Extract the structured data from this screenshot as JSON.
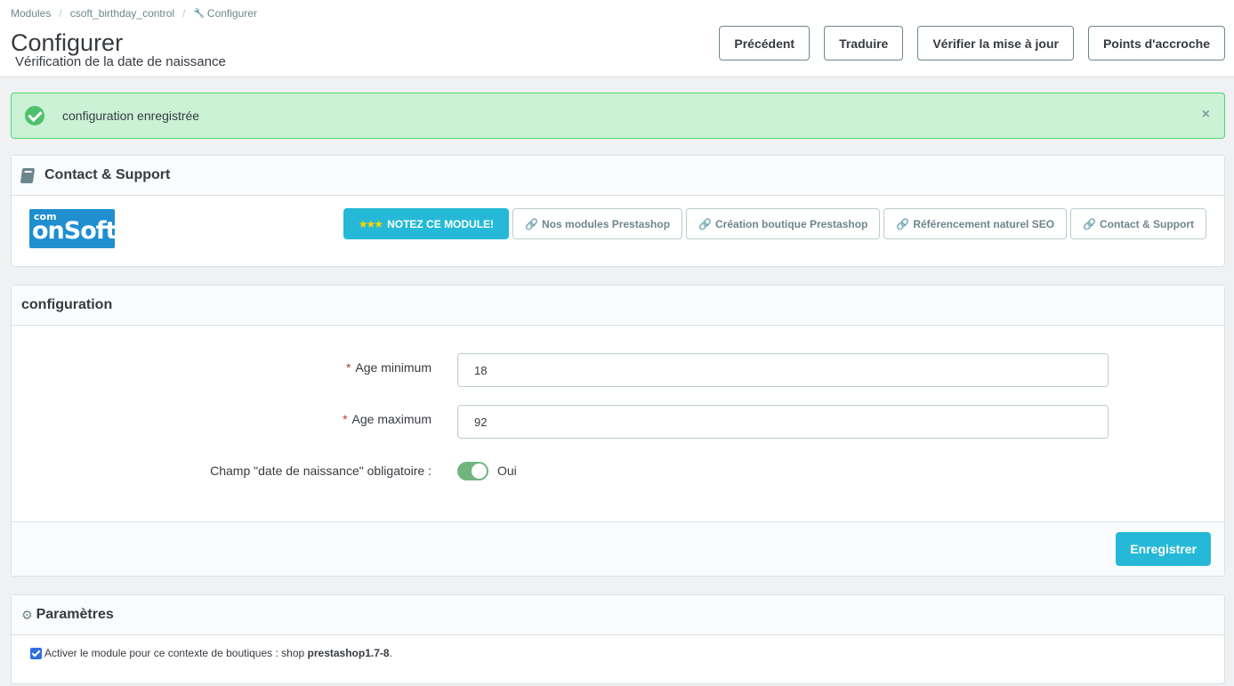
{
  "breadcrumb": {
    "item1": "Modules",
    "item2": "csoft_birthday_control",
    "item3": "Configurer",
    "separator": "/"
  },
  "header": {
    "title": "Configurer",
    "subtitle": "Vérification de la date de naissance"
  },
  "toolbar": {
    "back": "Précédent",
    "translate": "Traduire",
    "check_update": "Vérifier la mise à jour",
    "hooks": "Points d'accroche"
  },
  "alert": {
    "message": "configuration enregistrée",
    "close": "×"
  },
  "support": {
    "title": "Contact & Support",
    "logo_top": "com",
    "logo_brand": "onSoft",
    "rate_stars": "★★★",
    "rate_label": "NOTEZ CE MODULE!",
    "links": [
      "Nos modules Prestashop",
      "Création boutique Prestashop",
      "Référencement naturel SEO",
      "Contact & Support"
    ]
  },
  "config": {
    "title": "configuration",
    "required_mark": "*",
    "age_min_label": "Age minimum",
    "age_min_value": "18",
    "age_max_label": "Age maximum",
    "age_max_value": "92",
    "birthdate_label": "Champ \"date de naissance\" obligatoire :",
    "birthdate_state": "Oui",
    "save": "Enregistrer"
  },
  "params": {
    "title": "Paramètres",
    "activate_prefix": "Activer le module pour ce contexte de boutiques : shop",
    "shop_name": "prestashop1.7-8",
    "activate_suffix": "."
  },
  "colors": {
    "primary": "#25b9d7",
    "success_bg": "#cbf2d4",
    "success_border": "#53d572",
    "switch_on": "#70b580"
  },
  "icons": {
    "link": "link-icon",
    "wrench": "wrench-icon",
    "book": "book-icon",
    "cogs": "cogs-icon",
    "check": "check-circle-icon"
  }
}
